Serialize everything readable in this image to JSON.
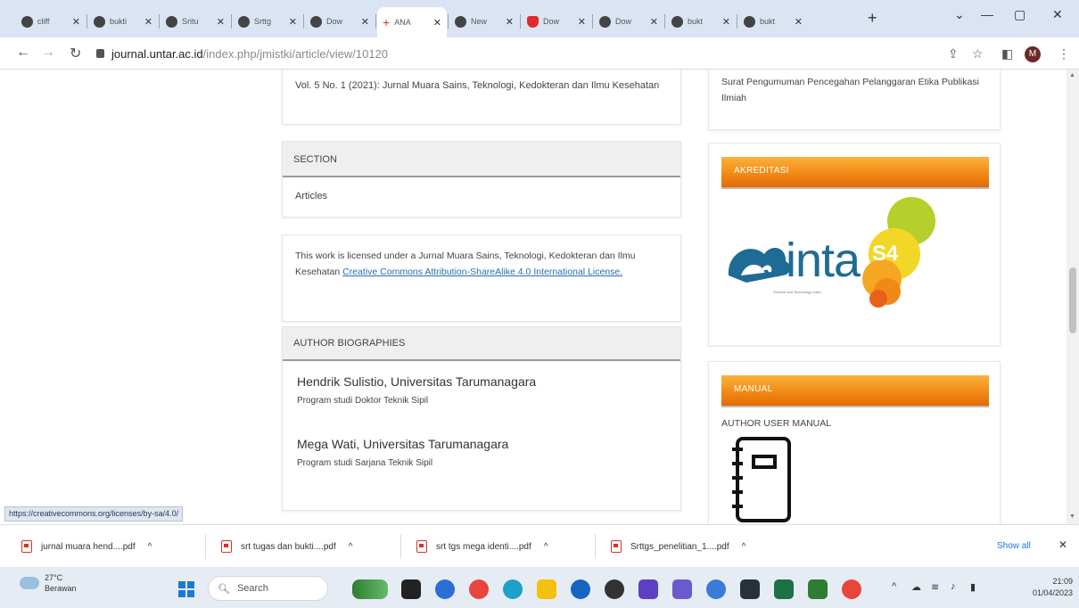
{
  "browser": {
    "tabs": [
      {
        "label": "cliff",
        "icon": "globe-icon"
      },
      {
        "label": "bukti",
        "icon": "globe-icon"
      },
      {
        "label": "Sritu",
        "icon": "globe-icon"
      },
      {
        "label": "Srttg",
        "icon": "globe-icon"
      },
      {
        "label": "Dow",
        "icon": "globe-icon"
      },
      {
        "label": "ANA",
        "icon": "add-icon",
        "active": true
      },
      {
        "label": "New",
        "icon": "globe-icon"
      },
      {
        "label": "Dow",
        "icon": "bookmark-icon"
      },
      {
        "label": "Dow",
        "icon": "globe-icon"
      },
      {
        "label": "bukt",
        "icon": "globe-icon"
      },
      {
        "label": "bukt",
        "icon": "globe-icon"
      }
    ],
    "new_tab": "+",
    "url_domain": "journal.untar.ac.id",
    "url_path": "/index.php/jmistki/article/view/10120",
    "profile_initial": "M"
  },
  "article": {
    "issue_text": "Vol. 5 No. 1 (2021): Jurnal Muara Sains, Teknologi, Kedokteran dan Ilmu Kesehatan",
    "section_heading": "SECTION",
    "section_value": "Articles",
    "license_text": "This work is licensed under a Jurnal Muara Sains, Teknologi, Kedokteran dan Ilmu Kesehatan ",
    "license_link": "Creative Commons Attribution-ShareAlike 4.0 International License.",
    "bios_heading": "AUTHOR BIOGRAPHIES",
    "authors": [
      {
        "name": "Hendrik Sulistio, Universitas Tarumanagara",
        "desc": "Program studi Doktor Teknik Sipil"
      },
      {
        "name": "Mega Wati, Universitas Tarumanagara",
        "desc": "Program studi Sarjana Teknik Sipil"
      }
    ]
  },
  "sidebar": {
    "announcement": "Surat Pengumuman Pencegahan Pelanggaran Etika Publikasi Ilmiah",
    "akreditasi_title": "AKREDITASI",
    "sinta_word": "sinta",
    "sinta_badge": "S4",
    "sinta_tagline": "Science and Technology Index",
    "manual_title": "MANUAL",
    "manual_label": "AUTHOR USER MANUAL"
  },
  "status_url": "https://creativecommons.org/licenses/by-sa/4.0/",
  "downloads": [
    {
      "name": "jurnal muara hend....pdf"
    },
    {
      "name": "srt tugas dan bukti....pdf"
    },
    {
      "name": "srt tgs mega identi....pdf"
    },
    {
      "name": "Srttgs_penelitian_1....pdf"
    }
  ],
  "downloads_show_all": "Show all",
  "taskbar": {
    "weather_temp": "27°C",
    "weather_desc": "Berawan",
    "search_placeholder": "Search",
    "time": "21:09",
    "date": "01/04/2023"
  },
  "colors": {
    "accent_orange": "#f08a16",
    "link_blue": "#2a6db3",
    "sinta_blue": "#1e6b96"
  }
}
